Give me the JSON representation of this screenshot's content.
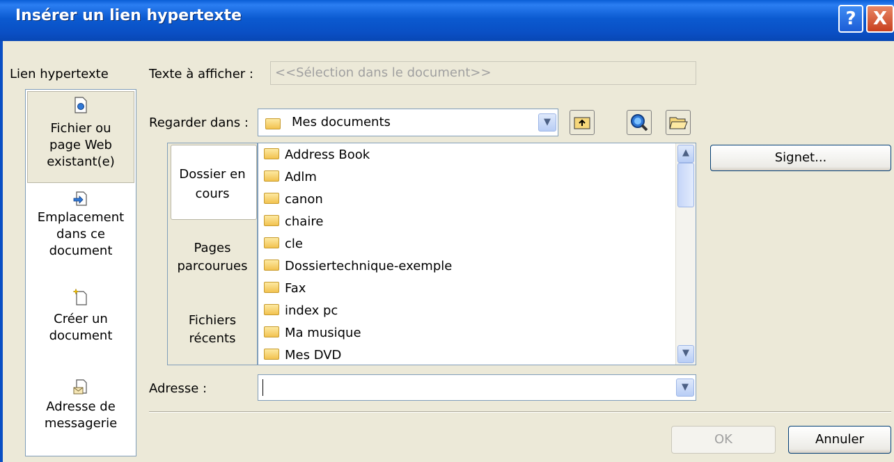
{
  "window": {
    "title": "Insérer un lien hypertexte",
    "help_label": "?",
    "close_label": "X"
  },
  "left_panel": {
    "heading": "Lien hypertexte",
    "items": [
      {
        "label_lines": [
          "Fichier ou",
          "page Web",
          "existant(e)"
        ],
        "icon": "file-icon",
        "selected": true
      },
      {
        "label_lines": [
          "Emplacement",
          "dans ce",
          "document"
        ],
        "icon": "document-location-icon"
      },
      {
        "label_lines": [
          "Créer un",
          "document"
        ],
        "icon": "new-document-icon"
      },
      {
        "label_lines": [
          "Adresse de",
          "messagerie"
        ],
        "icon": "email-icon"
      }
    ]
  },
  "text_to_display": {
    "label": "Texte à afficher :",
    "value": "<<Sélection dans le document>>"
  },
  "look_in": {
    "label": "Regarder dans :",
    "value": "Mes documents"
  },
  "middle_tabs": [
    {
      "label_lines": [
        "Dossier en",
        "cours"
      ],
      "selected": true
    },
    {
      "label_lines": [
        "Pages",
        "parcourues"
      ]
    },
    {
      "label_lines": [
        "Fichiers",
        "récents"
      ]
    }
  ],
  "files": [
    {
      "name": "Address Book",
      "icon": "folder-icon"
    },
    {
      "name": "Adlm",
      "icon": "folder-icon"
    },
    {
      "name": "canon",
      "icon": "folder-icon"
    },
    {
      "name": "chaire",
      "icon": "folder-icon"
    },
    {
      "name": "cle",
      "icon": "folder-icon"
    },
    {
      "name": "Dossiertechnique-exemple",
      "icon": "folder-icon"
    },
    {
      "name": "Fax",
      "icon": "folder-icon"
    },
    {
      "name": "index pc",
      "icon": "folder-icon"
    },
    {
      "name": "Ma musique",
      "icon": "music-folder-icon"
    },
    {
      "name": "Mes DVD",
      "icon": "folder-icon"
    }
  ],
  "address": {
    "label": "Adresse :",
    "value": ""
  },
  "buttons": {
    "bookmark": "Signet...",
    "ok": "OK",
    "cancel": "Annuler"
  },
  "colors": {
    "title_bar": "#0a5ed6",
    "dialog_bg": "#ece9d8",
    "border": "#7f9db9"
  }
}
